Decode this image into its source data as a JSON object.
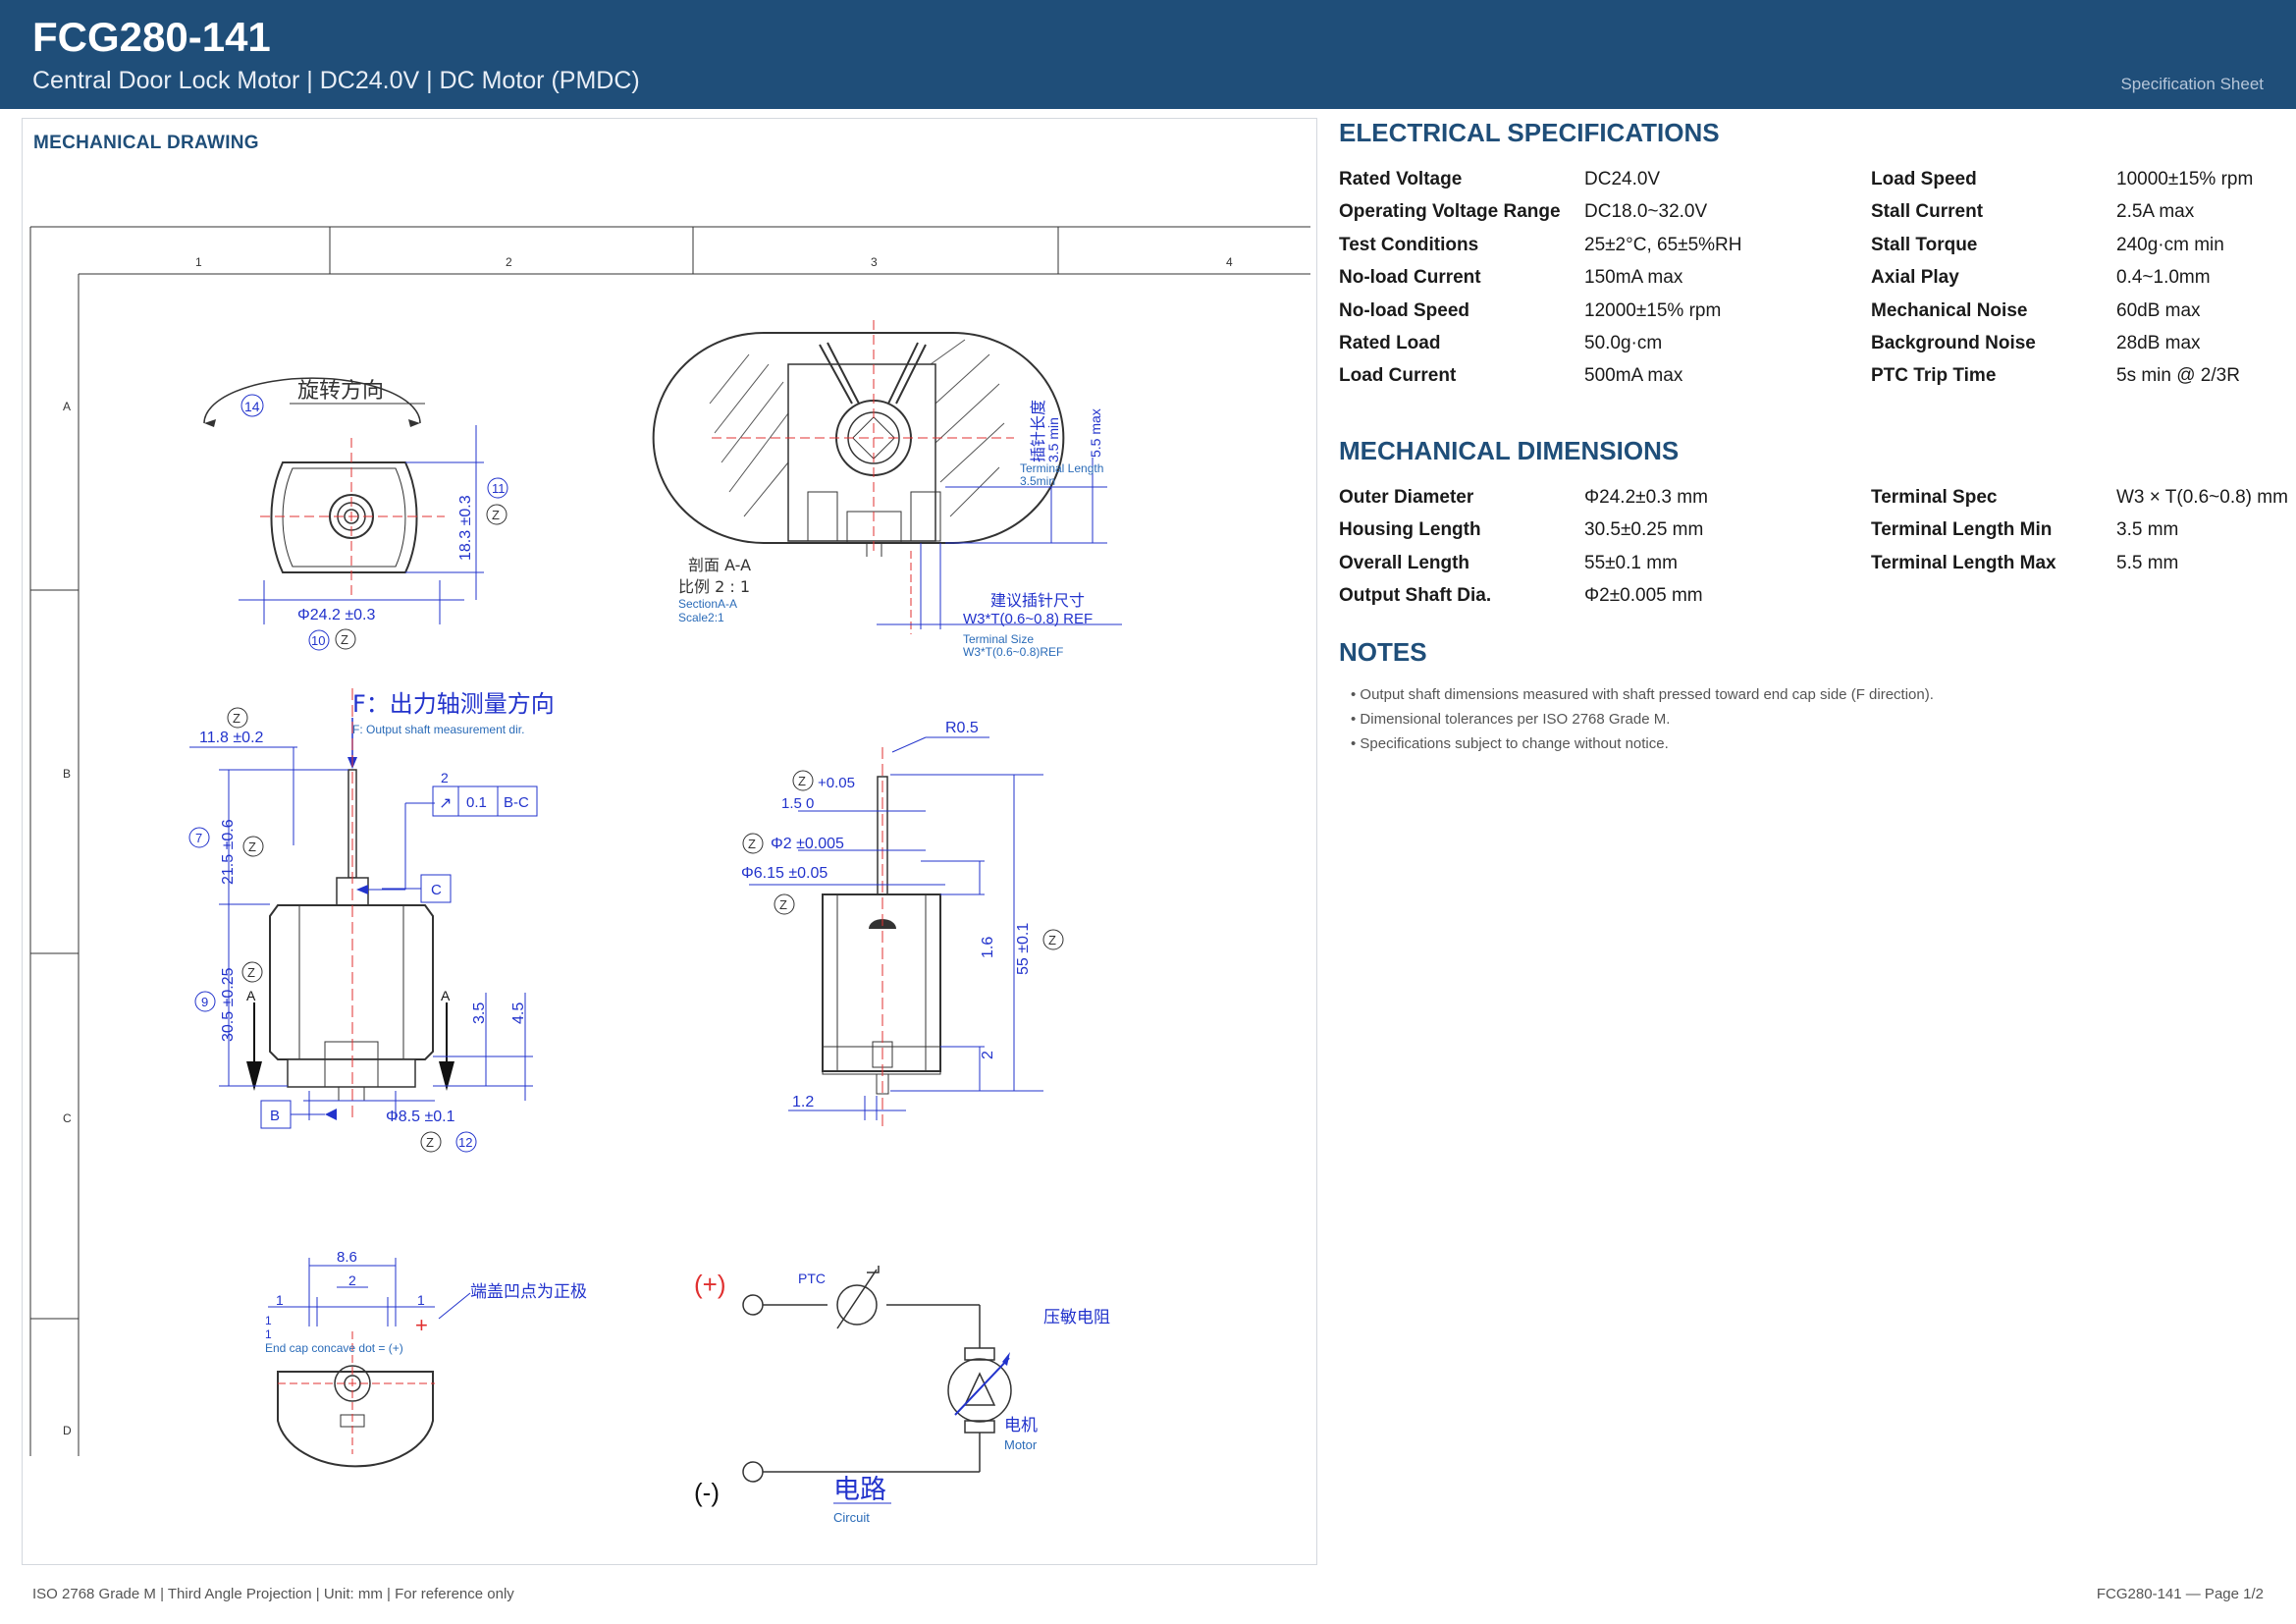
{
  "header": {
    "title": "FCG280-141",
    "subtitle": "Central Door Lock Motor  |  DC24.0V  |  DC Motor (PMDC)",
    "sheet_label": "Specification Sheet"
  },
  "drawing_panel": {
    "title": "MECHANICAL DRAWING",
    "columns": [
      "1",
      "2",
      "3",
      "4"
    ],
    "rows": [
      "A",
      "B",
      "C",
      "D"
    ],
    "view_top": {
      "rotation_label": "旋转方向",
      "bubble_14": "14",
      "dim_height": "18.3 ±0.3",
      "bubble_11": "11",
      "dim_diameter": "Φ24.2 ±0.3",
      "bubble_10": "10",
      "z": "Z"
    },
    "section": {
      "section_label": "剖面 A-A",
      "scale_label": "比例 2 : 1",
      "section_en": "SectionA-A",
      "scale_en": "Scale2:1",
      "pin_length_cn": "插针长度",
      "dim_min": "3.5 min",
      "dim_max": "5.5 max",
      "terminal_length": "Terminal Length",
      "terminal_min": "3.5min",
      "pin_size_cn": "建议插针尺寸",
      "pin_size_dim": "W3*T(0.6~0.8) REF",
      "terminal_size": "Terminal Size",
      "terminal_size_dim": "W3*T(0.6~0.8)REF"
    },
    "side_view": {
      "force_title": "F：出力轴测量方向",
      "force_en": "F: Output shaft measurement dir.",
      "dim_11_8": "11.8 ±0.2",
      "dim_21_5": "21.5 ±0.6",
      "bubble_7": "7",
      "dim_30_5": "30.5 ±0.25",
      "bubble_9": "9",
      "dim_3_5": "3.5",
      "dim_4_5": "4.5",
      "dim_8_5": "Φ8.5 ±0.1",
      "bubble_12": "12",
      "tol_num": "2",
      "tol_sym": "↗",
      "tol_val": "0.1",
      "tol_ref": "B-C",
      "datum_c": "C",
      "datum_b": "B",
      "section_a": "A"
    },
    "front_view": {
      "r05": "R0.5",
      "tol_plus": "+0.05",
      "dim_1_5": "1.5  0",
      "dim_phi2": "Φ2 ±0.005",
      "dim_phi615": "Φ6.15 ±0.05",
      "dim_1_6": "1.6",
      "dim_55": "55 ±0.1",
      "dim_2": "2",
      "dim_1_2": "1.2"
    },
    "end_cap": {
      "dim_8_6": "8.6",
      "dim_2": "2",
      "dim_1": "1",
      "polarity_cn": "端盖凹点为正极",
      "polarity_en": "End cap concave dot = (+)",
      "plus": "+"
    },
    "circuit": {
      "plus_label": "(+)",
      "minus_label": "(-)",
      "ptc": "PTC",
      "varistor_cn": "压敏电阻",
      "motor_cn": "电机",
      "motor_en": "Motor",
      "circuit_cn": "电路",
      "circuit_en": "Circuit"
    }
  },
  "electrical": {
    "title": "ELECTRICAL SPECIFICATIONS",
    "rows": [
      {
        "k1": "Rated Voltage",
        "v1": "DC24.0V",
        "k2": "Load Speed",
        "v2": "10000±15% rpm"
      },
      {
        "k1": "Operating Voltage Range",
        "v1": "DC18.0~32.0V",
        "k2": "Stall Current",
        "v2": "2.5A max"
      },
      {
        "k1": "Test Conditions",
        "v1": "25±2°C, 65±5%RH",
        "k2": "Stall Torque",
        "v2": "240g·cm min"
      },
      {
        "k1": "No-load Current",
        "v1": "150mA max",
        "k2": "Axial Play",
        "v2": "0.4~1.0mm"
      },
      {
        "k1": "No-load Speed",
        "v1": "12000±15% rpm",
        "k2": "Mechanical Noise",
        "v2": "60dB max"
      },
      {
        "k1": "Rated Load",
        "v1": "50.0g·cm",
        "k2": "Background Noise",
        "v2": "28dB max"
      },
      {
        "k1": "Load Current",
        "v1": "500mA max",
        "k2": "PTC Trip Time",
        "v2": "5s min @ 2/3R"
      }
    ]
  },
  "mechanical": {
    "title": "MECHANICAL DIMENSIONS",
    "rows": [
      {
        "k1": "Outer Diameter",
        "v1": "Φ24.2±0.3 mm",
        "k2": "Terminal Spec",
        "v2": "W3 × T(0.6~0.8) mm"
      },
      {
        "k1": "Housing Length",
        "v1": "30.5±0.25 mm",
        "k2": "Terminal Length Min",
        "v2": "3.5 mm"
      },
      {
        "k1": "Overall Length",
        "v1": "55±0.1 mm",
        "k2": "Terminal Length Max",
        "v2": "5.5 mm"
      },
      {
        "k1": "Output Shaft Dia.",
        "v1": "Φ2±0.005 mm",
        "k2": "",
        "v2": ""
      }
    ]
  },
  "notes": {
    "title": "NOTES",
    "items": [
      "• Output shaft dimensions measured with shaft pressed toward end cap side (F direction).",
      "• Dimensional tolerances per ISO 2768 Grade M.",
      "• Specifications subject to change without notice."
    ]
  },
  "footer": {
    "left": "ISO 2768 Grade M  |  Third Angle Projection  |  Unit: mm  |  For reference only",
    "right": "FCG280-141  —  Page 1/2"
  }
}
